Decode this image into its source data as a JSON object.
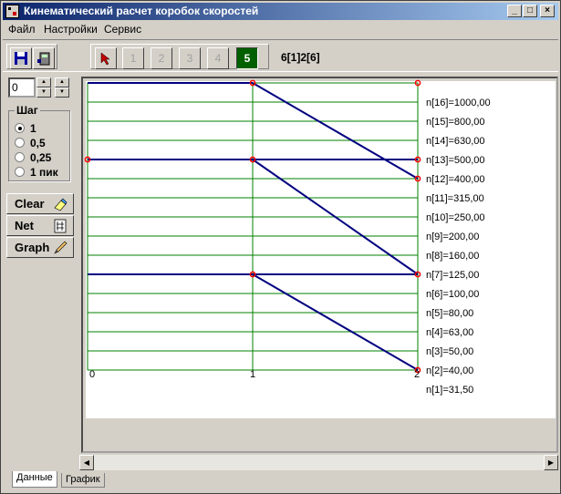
{
  "window": {
    "title": "Кинематический расчет коробок скоростей",
    "controls": {
      "minimize": "_",
      "maximize": "□",
      "close": "×"
    }
  },
  "menu": [
    "Файл",
    "Настройки",
    "Сервис"
  ],
  "toolbar": {
    "buttons": [
      "1",
      "2",
      "3",
      "4",
      "5"
    ],
    "active_button": "5",
    "gear_text": "6[1]2[6]"
  },
  "left_panel": {
    "spin_value": "0",
    "step_group": {
      "label": "Шаг",
      "options": [
        "1",
        "0,5",
        "0,25",
        "1 пик"
      ],
      "selected": "1"
    },
    "buttons": {
      "clear": "Clear",
      "net": "Net",
      "graph": "Graph"
    }
  },
  "chart_data": {
    "type": "line",
    "x_ticks": [
      "0",
      "1",
      "2"
    ],
    "speed_labels": [
      "n[16]=1000,00",
      "n[15]=800,00",
      "n[14]=630,00",
      "n[13]=500,00",
      "n[12]=400,00",
      "n[11]=315,00",
      "n[10]=250,00",
      "n[9]=200,00",
      "n[8]=160,00",
      "n[7]=125,00",
      "n[6]=100,00",
      "n[5]=80,00",
      "n[4]=63,00",
      "n[3]=50,00",
      "n[2]=40,00",
      "n[1]=31,50"
    ],
    "segments": [
      {
        "from": [
          0,
          16
        ],
        "to": [
          1,
          16
        ]
      },
      {
        "from": [
          1,
          16
        ],
        "to": [
          2,
          11
        ]
      },
      {
        "from": [
          0,
          12
        ],
        "to": [
          1,
          12
        ]
      },
      {
        "from": [
          1,
          12
        ],
        "to": [
          2,
          12
        ]
      },
      {
        "from": [
          1,
          12
        ],
        "to": [
          2,
          6
        ]
      },
      {
        "from": [
          0,
          6
        ],
        "to": [
          1,
          6
        ]
      },
      {
        "from": [
          1,
          6
        ],
        "to": [
          2,
          6
        ]
      },
      {
        "from": [
          1,
          6
        ],
        "to": [
          2,
          1
        ]
      }
    ],
    "points": [
      [
        1,
        16
      ],
      [
        2,
        16
      ],
      [
        0,
        12
      ],
      [
        1,
        12
      ],
      [
        2,
        12
      ],
      [
        2,
        11
      ],
      [
        1,
        6
      ],
      [
        2,
        6
      ],
      [
        2,
        1
      ]
    ],
    "colors": {
      "grid": "#008000",
      "line": "#000080",
      "point": "#ff0000"
    }
  },
  "tabs": [
    "Данные",
    "График"
  ],
  "active_tab": "Данные"
}
